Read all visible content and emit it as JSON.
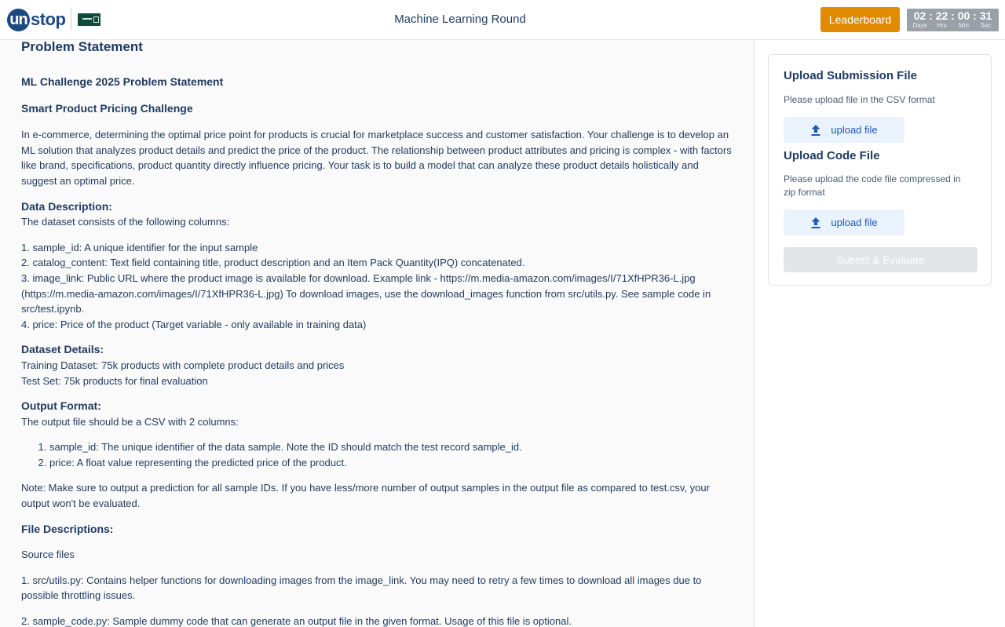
{
  "header": {
    "logo_text": "unstop",
    "logo_letter": "un",
    "title": "Machine Learning Round",
    "leaderboard_label": "Leaderboard",
    "timer": {
      "days": "02",
      "hours": "22",
      "minutes": "00",
      "seconds": "31",
      "days_label": "Days",
      "hours_label": "Hrs",
      "minutes_label": "Min",
      "seconds_label": "Sec",
      "separator": ":"
    }
  },
  "main": {
    "heading": "Problem Statement",
    "challenge_title": "ML Challenge 2025 Problem Statement",
    "challenge_subtitle": "Smart Product Pricing Challenge",
    "intro": "In e-commerce, determining the optimal price point for products is crucial for marketplace success and customer satisfaction. Your challenge is to develop an ML solution that analyzes product details and predict the price of the product. The relationship between product attributes and pricing is complex - with factors like brand, specifications, product quantity directly influence pricing. Your task is to build a model that can analyze these product details holistically and suggest an optimal price.",
    "data_description_heading": "Data Description:",
    "data_description_intro": "The dataset consists of the following columns:",
    "columns": [
      "1. sample_id: A unique identifier for the input sample",
      "2. catalog_content: Text field containing title, product description and an Item Pack Quantity(IPQ) concatenated.",
      "3. image_link: Public URL where the product image is available for download. Example link - https://m.media-amazon.com/images/I/71XfHPR36-L.jpg (https://m.media-amazon.com/images/I/71XfHPR36-L.jpg) To download images, use the download_images function from src/utils.py. See sample code in src/test.ipynb.",
      "4. price: Price of the product (Target variable - only available in training data)"
    ],
    "dataset_details_heading": "Dataset Details:",
    "dataset_details": [
      "Training Dataset: 75k products with complete product details and prices",
      "Test Set: 75k products for final evaluation"
    ],
    "output_format_heading": "Output Format:",
    "output_format_intro": "The output file should be a CSV with 2 columns:",
    "output_columns": [
      "sample_id: The unique identifier of the data sample. Note the ID should match the test record sample_id.",
      "price: A float value representing the predicted price of the product."
    ],
    "note": "Note: Make sure to output a prediction for all sample IDs. If you have less/more number of output samples in the output file as compared to test.csv, your output won't be evaluated.",
    "file_descriptions_heading": "File Descriptions:",
    "source_files_label": "Source files",
    "files": [
      "1. src/utils.py: Contains helper functions for downloading images from the image_link. You may need to retry a few times to download all images due to possible throttling issues.",
      "2. sample_code.py: Sample dummy code that can generate an output file in the given format. Usage of this file is optional."
    ]
  },
  "sidebar": {
    "submission_title": "Upload Submission File",
    "submission_desc": "Please upload file in the CSV format",
    "upload_label": "upload file",
    "code_title": "Upload Code File",
    "code_desc": "Please upload the code file compressed in zip format",
    "code_upload_label": "upload file",
    "submit_label": "Submit & Evaluate"
  },
  "colors": {
    "brand": "#1c4980",
    "accent": "#e08b00",
    "link": "#1c5bb8",
    "disabled": "#e2e4e7"
  },
  "icons": [
    "upload-icon"
  ]
}
